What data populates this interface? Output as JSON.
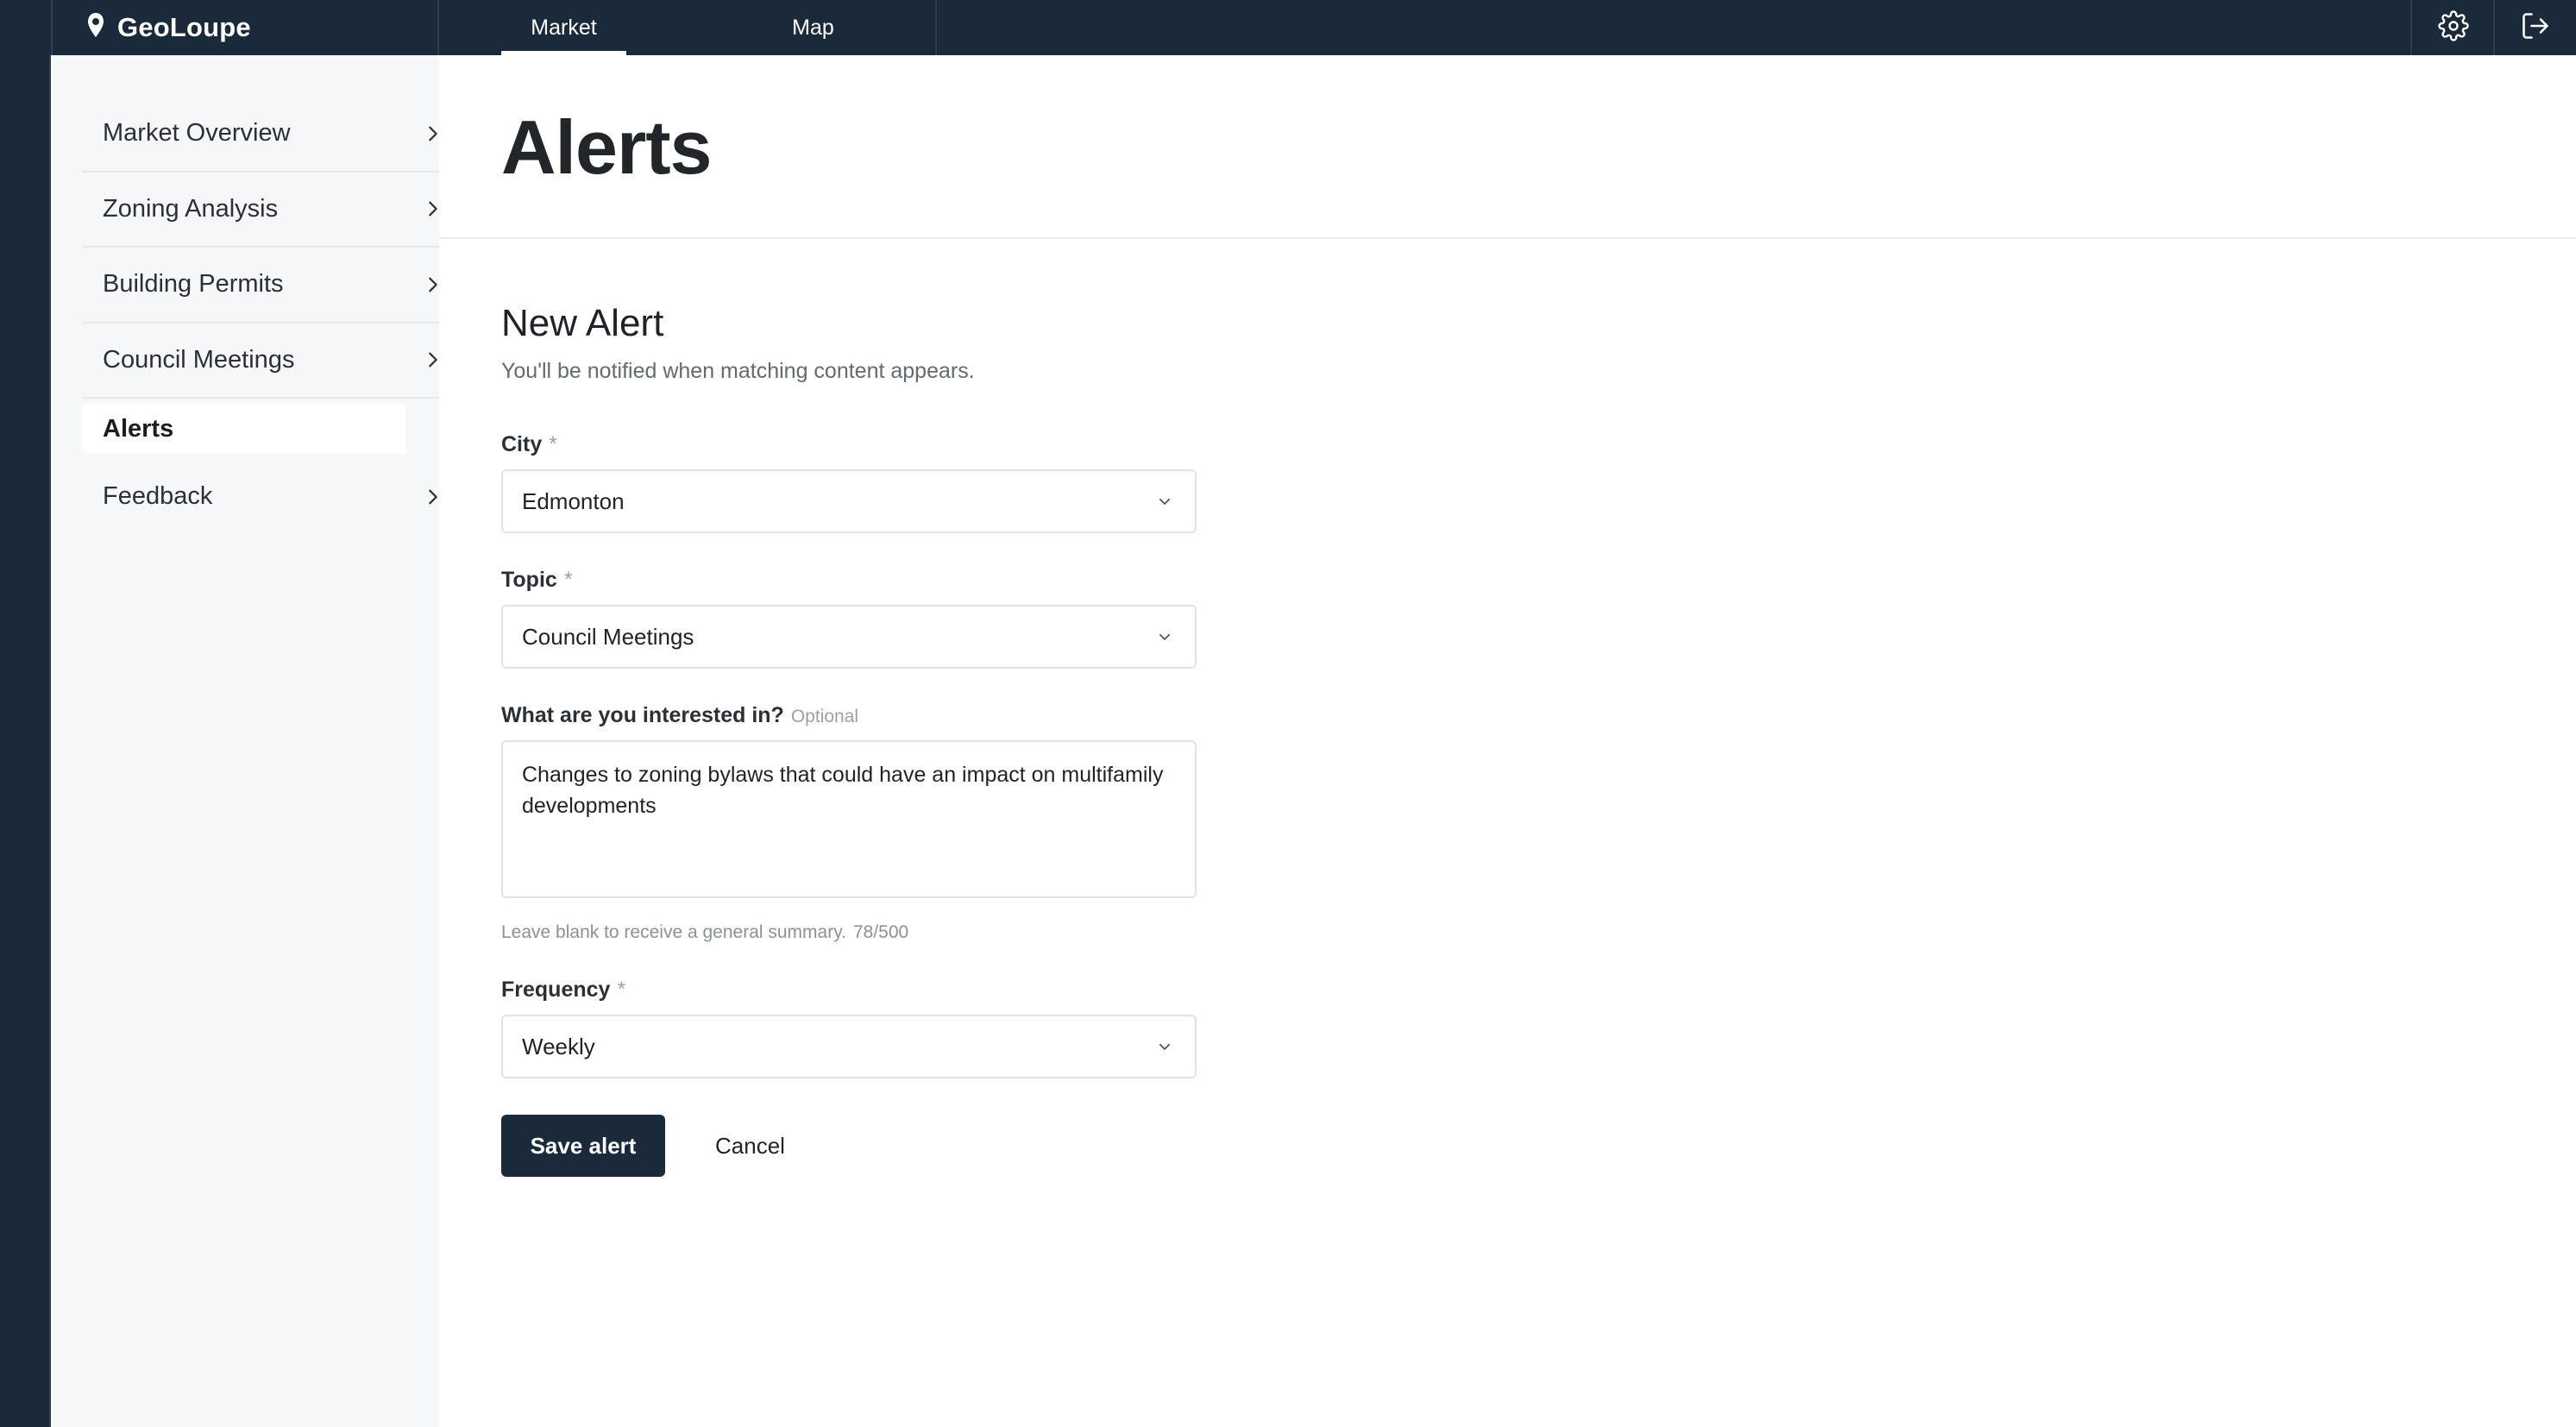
{
  "app": {
    "name": "GeoLoupe",
    "logo_icon": "pin-icon"
  },
  "topnav": {
    "tabs": [
      {
        "label": "Market",
        "active": true
      },
      {
        "label": "Map",
        "active": false
      }
    ],
    "icons": [
      "gear-icon",
      "logout-icon"
    ]
  },
  "sidebar": {
    "items": [
      {
        "label": "Market Overview",
        "has_chevron": true
      },
      {
        "label": "Zoning Analysis",
        "has_chevron": true
      },
      {
        "label": "Building Permits",
        "has_chevron": true
      },
      {
        "label": "Council Meetings",
        "has_chevron": true
      },
      {
        "label": "Alerts",
        "active": true
      },
      {
        "label": "Feedback",
        "has_chevron": true
      }
    ]
  },
  "page": {
    "title": "Alerts"
  },
  "form": {
    "title": "New Alert",
    "subtitle": "You'll be notified when matching content appears.",
    "required_mark": "*",
    "city": {
      "label": "City",
      "value": "Edmonton"
    },
    "topic": {
      "label": "Topic",
      "value": "Council Meetings"
    },
    "interest": {
      "label": "What are you interested in?",
      "optional_label": "Optional",
      "value": "Changes to zoning bylaws that could have an impact on multifamily developments",
      "hint": "Leave blank to receive a general summary.",
      "counter": "78/500"
    },
    "frequency": {
      "label": "Frequency",
      "value": "Weekly"
    },
    "save_label": "Save alert",
    "cancel_label": "Cancel"
  },
  "colors": {
    "navy": "#1b2a3b",
    "sidebar_bg": "#f6f7f8",
    "border": "#dfe2e6",
    "muted_text": "#626a72"
  }
}
